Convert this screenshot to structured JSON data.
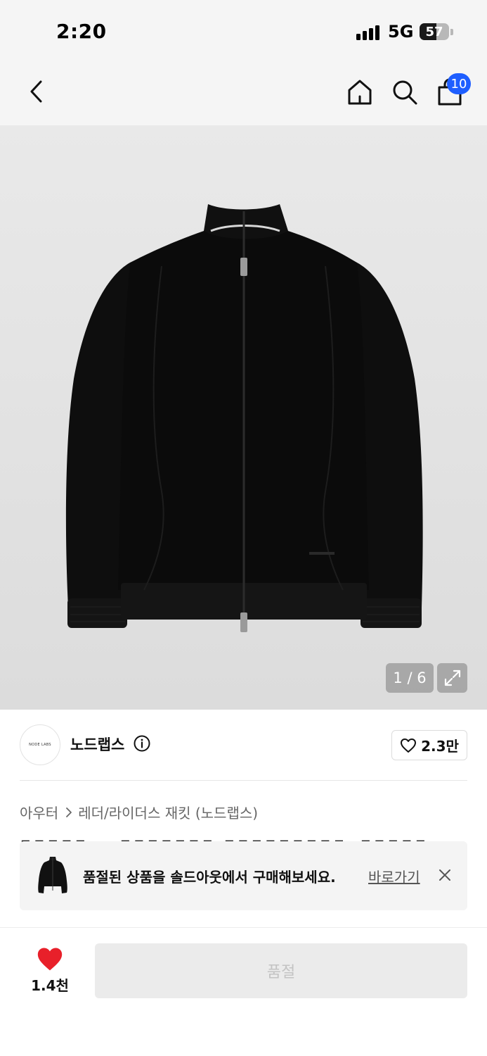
{
  "status_bar": {
    "time": "2:20",
    "network": "5G",
    "battery_level": "57",
    "battery_fraction": 0.57,
    "icons": [
      "signal-icon",
      "battery-icon"
    ]
  },
  "nav": {
    "icons": [
      "back-chevron-icon",
      "home-icon",
      "search-icon",
      "shopping-bag-icon"
    ],
    "cart_count": "10",
    "accent_color": "#1e5eff"
  },
  "gallery": {
    "image_subject": "black zip-up jacket",
    "page_counter": "1 / 6",
    "expand_icon": "expand-arrows-icon"
  },
  "brand": {
    "logo_text": "NODE LABS",
    "name": "노드랩스",
    "info_icon": "info-circle-icon",
    "favorite_icon": "heart-outline-icon",
    "favorite_count": "2.3만"
  },
  "breadcrumb": {
    "items": [
      "아우터",
      "레더/라이더스 재킷 (노드랩스)"
    ],
    "separator_icon": "chevron-right-icon"
  },
  "soldout_banner": {
    "message": "품절된 상품을 솔드아웃에서 구매해보세요.",
    "link_label": "바로가기",
    "close_icon": "close-icon"
  },
  "bottom_bar": {
    "like_icon": "heart-filled-icon",
    "like_color": "#e8202a",
    "like_count": "1.4천",
    "buy_label": "품절"
  }
}
